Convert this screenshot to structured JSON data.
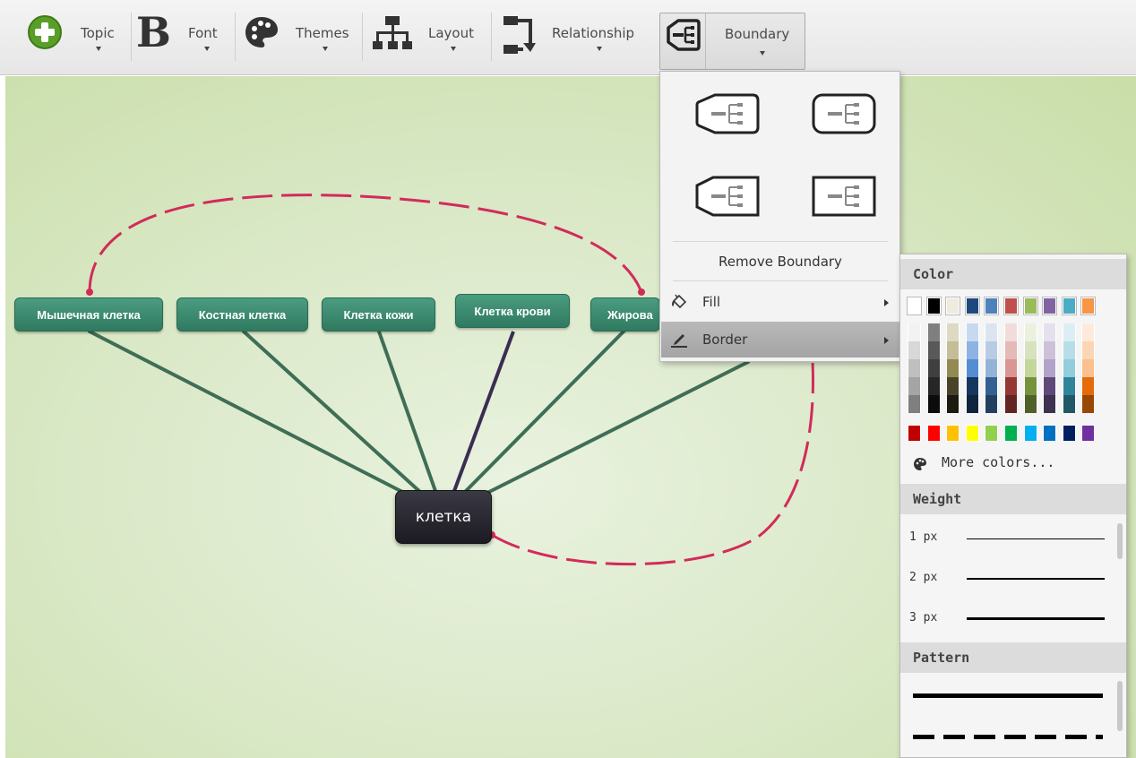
{
  "toolbar": {
    "topic_label": "Topic",
    "font_label": "Font",
    "themes_label": "Themes",
    "layout_label": "Layout",
    "relationship_label": "Relationship",
    "boundary_label": "Boundary"
  },
  "mindmap": {
    "central": "клетка",
    "nodes": [
      "Мышечная клетка",
      "Костная клетка",
      "Клетка кожи",
      "Клетка крови",
      "Жирова"
    ]
  },
  "boundary_menu": {
    "remove_label": "Remove Boundary",
    "fill_label": "Fill",
    "border_label": "Border"
  },
  "border_submenu": {
    "color_header": "Color",
    "more_colors": "More colors...",
    "weight_header": "Weight",
    "weights": [
      "1 px",
      "2 px",
      "3 px"
    ],
    "pattern_header": "Pattern"
  },
  "colors": {
    "accent": "#d22b5a",
    "node": "#3d8c70",
    "central": "#2a2830",
    "canvas": "#dbe9c9"
  },
  "palette": {
    "top": [
      "#ffffff",
      "#000000",
      "#eeece1",
      "#1f497d",
      "#4f81bd",
      "#c0504d",
      "#9bbb59",
      "#8064a2",
      "#4bacc6",
      "#f79646"
    ],
    "tints": [
      [
        "#f2f2f2",
        "#d8d8d8",
        "#bfbfbf",
        "#a5a5a5",
        "#7f7f7f"
      ],
      [
        "#7f7f7f",
        "#595959",
        "#3f3f3f",
        "#262626",
        "#0c0c0c"
      ],
      [
        "#ddd9c3",
        "#c4bd97",
        "#938953",
        "#494429",
        "#1d1b10"
      ],
      [
        "#c6d9f0",
        "#8db3e2",
        "#548dd4",
        "#17365d",
        "#0f243e"
      ],
      [
        "#dbe5f1",
        "#b8cce4",
        "#95b3d7",
        "#366092",
        "#244061"
      ],
      [
        "#f2dcdb",
        "#e5b9b7",
        "#d99694",
        "#953734",
        "#632423"
      ],
      [
        "#ebf1dd",
        "#d7e3bc",
        "#c3d69b",
        "#76923c",
        "#4f6128"
      ],
      [
        "#e5e0ec",
        "#ccc1d9",
        "#b2a2c7",
        "#5f497a",
        "#3f3151"
      ],
      [
        "#dbeef3",
        "#b7dde8",
        "#92cddc",
        "#31859b",
        "#205867"
      ],
      [
        "#fdeada",
        "#fbd5b5",
        "#fac08f",
        "#e36c09",
        "#974806"
      ]
    ],
    "standard": [
      "#c00000",
      "#ff0000",
      "#ffc000",
      "#ffff00",
      "#92d050",
      "#00b050",
      "#00b0f0",
      "#0070c0",
      "#002060",
      "#7030a0"
    ]
  }
}
